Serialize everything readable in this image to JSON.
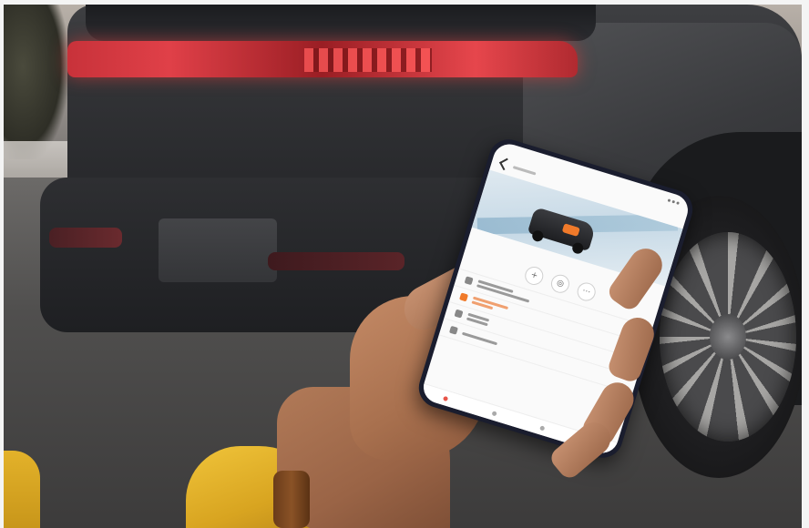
{
  "scene": {
    "description_kind": "photo",
    "subject_colors": {
      "taillight": "#e04048",
      "sleeve": "#f0c43a",
      "phone_accent": "#e8554a",
      "app_highlight": "#f07a2a"
    }
  },
  "phone_screen": {
    "status_time": "",
    "vehicle_name": "",
    "controls": [
      {
        "icon": "plus-icon",
        "glyph": "+"
      },
      {
        "icon": "circle-icon",
        "glyph": "◎"
      },
      {
        "icon": "ellipsis-icon",
        "glyph": "⋯"
      }
    ],
    "nav_items": [
      {
        "icon": "home-icon"
      },
      {
        "icon": "car-icon"
      },
      {
        "icon": "map-icon"
      },
      {
        "icon": "profile-icon"
      }
    ]
  }
}
